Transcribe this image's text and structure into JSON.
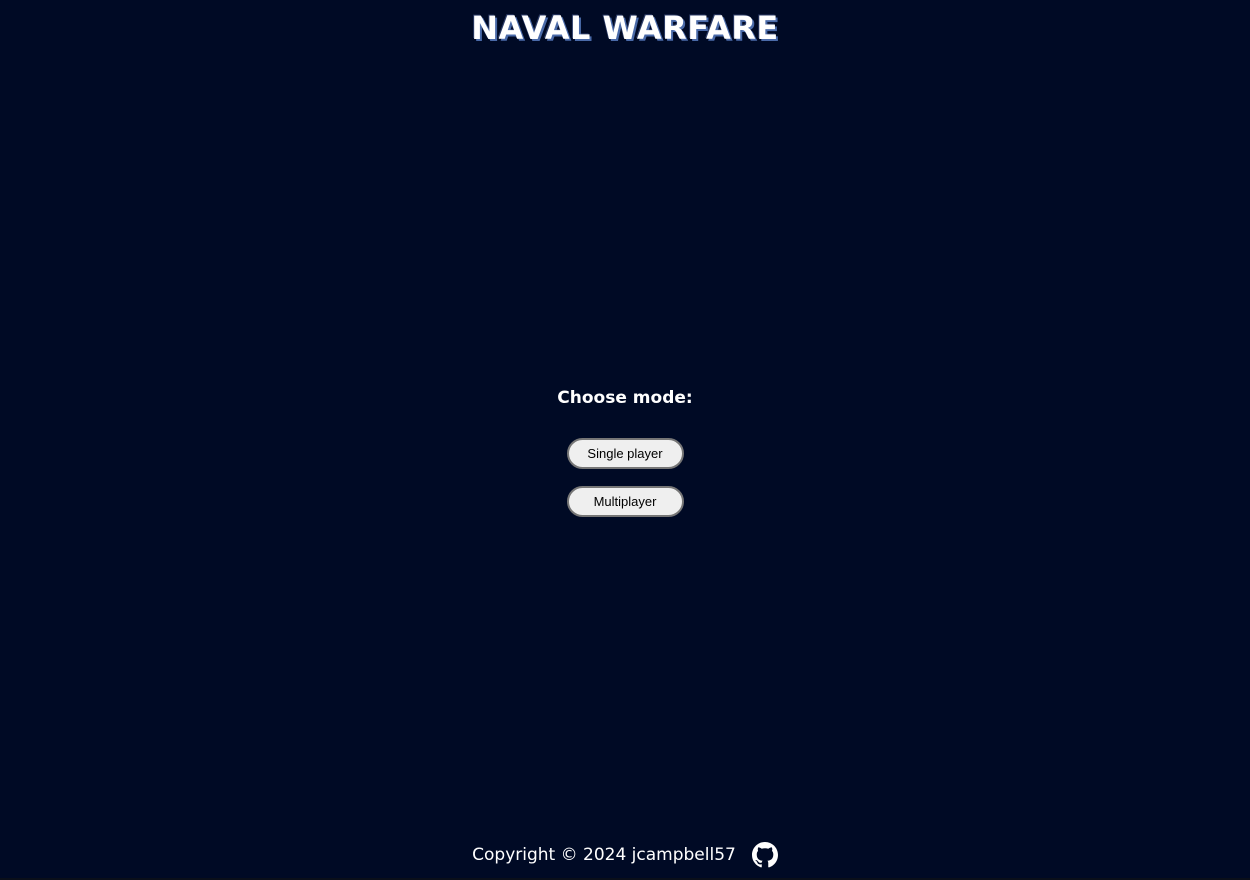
{
  "header": {
    "title": "NAVAL WARFARE"
  },
  "mode_select": {
    "label": "Choose mode:",
    "buttons": [
      {
        "label": "Single player"
      },
      {
        "label": "Multiplayer"
      }
    ]
  },
  "footer": {
    "copyright": "Copyright © 2024 jcampbell57",
    "github_icon": "github-icon"
  },
  "colors": {
    "background": "#000a25",
    "text": "#ffffff",
    "button_bg": "#efefef",
    "button_border": "#767676"
  }
}
